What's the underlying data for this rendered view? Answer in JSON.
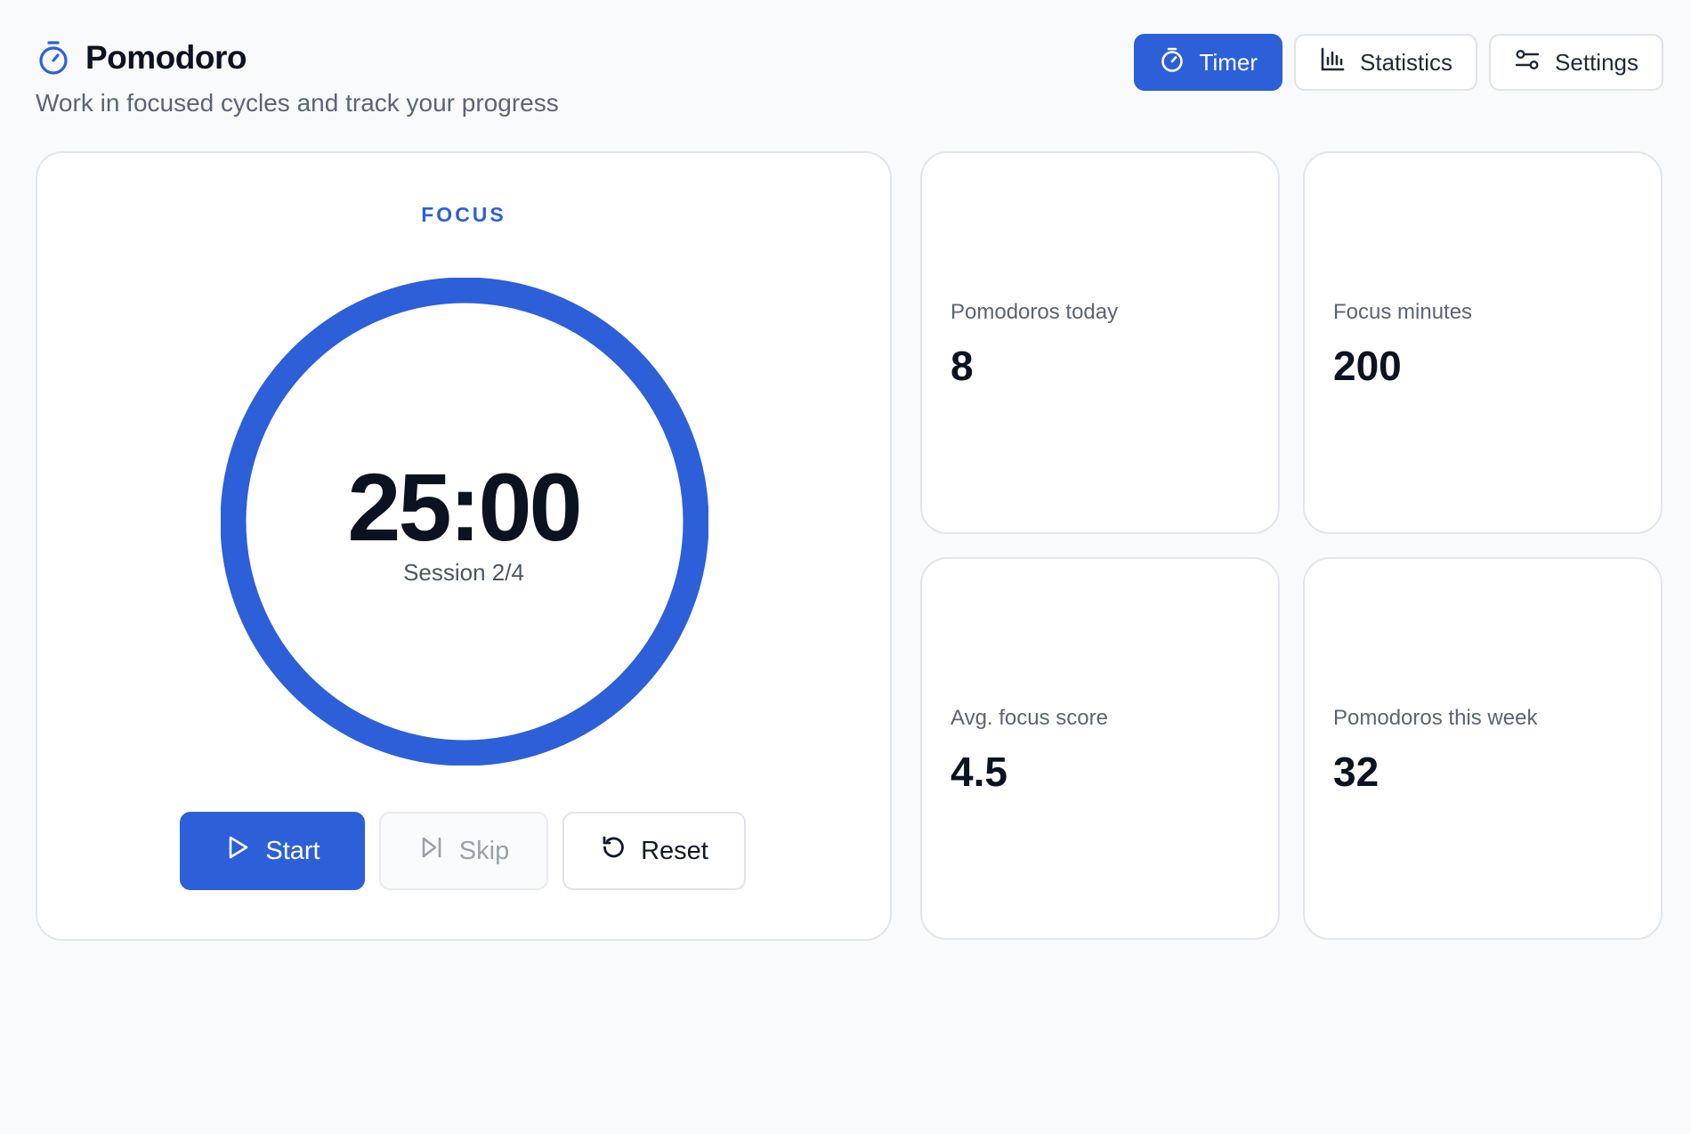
{
  "app": {
    "title": "Pomodoro",
    "subtitle": "Work in focused cycles and track your progress",
    "icon": "stopwatch-icon"
  },
  "nav": {
    "timer": {
      "label": "Timer",
      "icon": "stopwatch-icon",
      "active": true
    },
    "statistics": {
      "label": "Statistics",
      "icon": "bar-chart-icon",
      "active": false
    },
    "settings": {
      "label": "Settings",
      "icon": "sliders-icon",
      "active": false
    }
  },
  "timer": {
    "mode": "FOCUS",
    "time": "25:00",
    "session": "Session 2/4",
    "progress": 1.0
  },
  "controls": {
    "start": {
      "label": "Start",
      "icon": "play-icon"
    },
    "skip": {
      "label": "Skip",
      "icon": "skip-icon",
      "disabled": true
    },
    "reset": {
      "label": "Reset",
      "icon": "reset-icon"
    }
  },
  "stats": {
    "pomodoros_today": {
      "label": "Pomodoros today",
      "value": "8"
    },
    "focus_minutes": {
      "label": "Focus minutes",
      "value": "200"
    },
    "avg_focus_score": {
      "label": "Avg. focus score",
      "value": "4.5"
    },
    "pomodoros_week": {
      "label": "Pomodoros this week",
      "value": "32"
    }
  },
  "colors": {
    "accent": "#2d5fd8",
    "background": "#f9fafc",
    "card_border": "#e2e6ec",
    "text_primary": "#0b1220",
    "text_secondary": "#5b6474"
  }
}
